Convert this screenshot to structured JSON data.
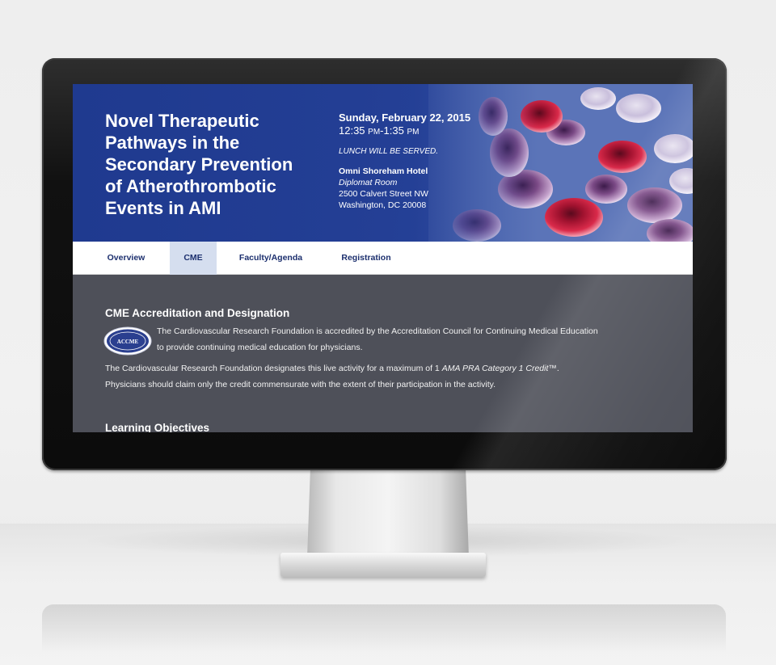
{
  "hero": {
    "title_lines": [
      "Novel Therapeutic",
      "Pathways in the",
      "Secondary Prevention",
      "of Atherothrombotic",
      "Events in AMI"
    ],
    "date": "Sunday, February 22, 2015",
    "time_start": "12:35",
    "time_end": "1:35",
    "time_suffix": "PM",
    "time_dash": "-",
    "lunch": "LUNCH WILL BE SERVED.",
    "venue": "Omni Shoreham Hotel",
    "room": "Diplomat Room",
    "street": "2500 Calvert Street NW",
    "city": "Washington, DC 20008"
  },
  "nav": {
    "items": [
      "Overview",
      "CME",
      "Faculty/Agenda",
      "Registration"
    ],
    "active": "CME"
  },
  "content": {
    "section1_heading": "CME Accreditation and Designation",
    "accreditation_line1": "The Cardiovascular Research Foundation is accredited by the Accreditation Council for Continuing Medical Education",
    "accreditation_line2": "to provide continuing medical education for physicians.",
    "designation_pre": "The Cardiovascular Research Foundation designates this live activity for a maximum of 1 ",
    "designation_credit": "AMA PRA Category 1 Credit",
    "designation_post": "™.",
    "designation_line2": "Physicians should claim only the credit commensurate with the extent of their participation in the activity.",
    "section2_heading": "Learning Objectives",
    "logo_text": "ACCME"
  },
  "colors": {
    "hero_blue": "#233f95",
    "nav_text": "#1c2f6e",
    "nav_active_bg": "#d5deef",
    "content_bg": "#4e5059",
    "blood_cell": "#c0163a"
  },
  "icons": [
    "accme-logo-icon"
  ]
}
